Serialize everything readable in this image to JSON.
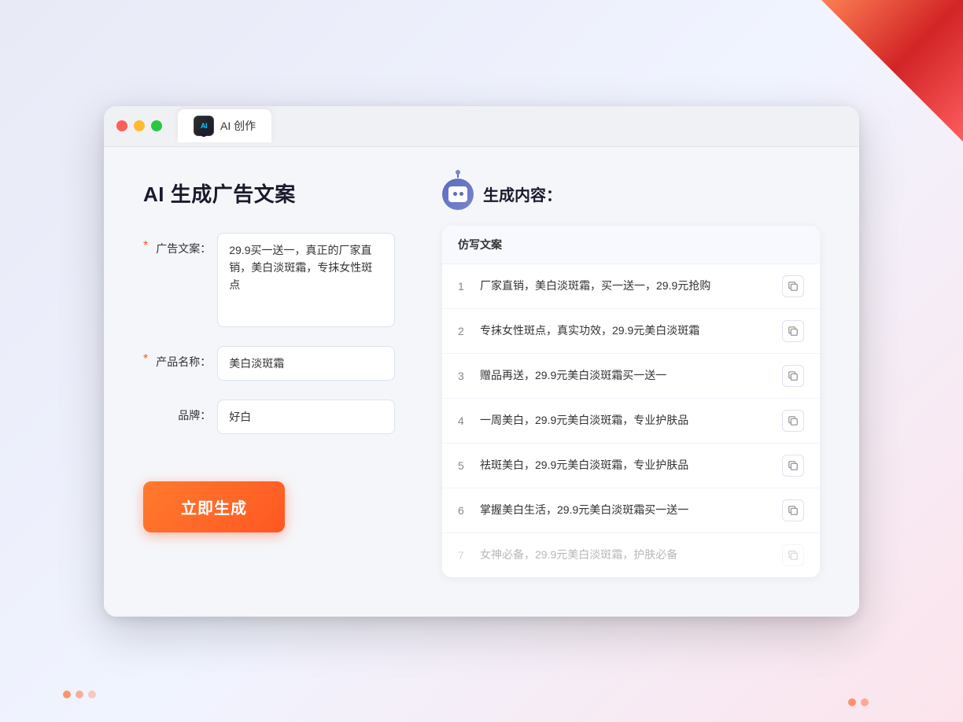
{
  "window": {
    "tab_label": "AI 创作",
    "tab_icon": "AI"
  },
  "left_panel": {
    "title": "AI 生成广告文案",
    "ad_copy_label": "广告文案：",
    "ad_copy_value": "29.9买一送一，真正的厂家直销，美白淡斑霜，专抹女性斑点",
    "product_label": "产品名称：",
    "product_value": "美白淡斑霜",
    "brand_label": "品牌：",
    "brand_value": "好白",
    "generate_btn": "立即生成"
  },
  "right_panel": {
    "title": "生成内容：",
    "table_header": "仿写文案",
    "results": [
      {
        "num": "1",
        "text": "厂家直销，美白淡斑霜，买一送一，29.9元抢购",
        "faded": false
      },
      {
        "num": "2",
        "text": "专抹女性斑点，真实功效，29.9元美白淡斑霜",
        "faded": false
      },
      {
        "num": "3",
        "text": "赠品再送，29.9元美白淡斑霜买一送一",
        "faded": false
      },
      {
        "num": "4",
        "text": "一周美白，29.9元美白淡斑霜，专业护肤品",
        "faded": false
      },
      {
        "num": "5",
        "text": "祛斑美白，29.9元美白淡斑霜，专业护肤品",
        "faded": false
      },
      {
        "num": "6",
        "text": "掌握美白生活，29.9元美白淡斑霜买一送一",
        "faded": false
      },
      {
        "num": "7",
        "text": "女神必备，29.9元美白淡斑霜，护肤必备",
        "faded": true
      }
    ]
  },
  "colors": {
    "accent": "#ff5722",
    "primary": "#5c6bc0",
    "text_dark": "#1a1a2e",
    "text_gray": "#888"
  }
}
